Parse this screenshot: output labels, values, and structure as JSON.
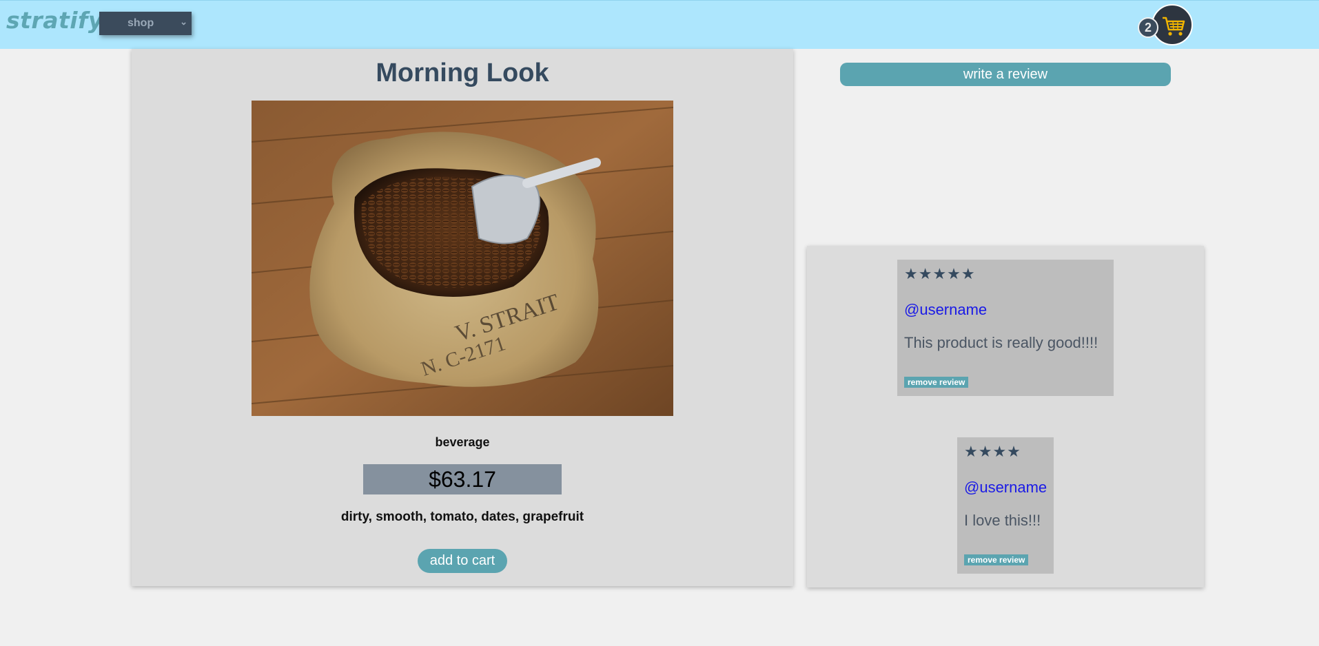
{
  "header": {
    "logo": "stratify",
    "shop_select": {
      "selected": "shop"
    },
    "cart": {
      "count": "2",
      "icon": "cart-icon"
    }
  },
  "product": {
    "title": "Morning Look",
    "category": "beverage",
    "price": "$63.17",
    "tags": "dirty, smooth, tomato, dates, grapefruit",
    "add_to_cart_label": "add to cart"
  },
  "reviews": {
    "write_review_label": "write a review",
    "items": [
      {
        "stars": "★★★★★",
        "user": "@username",
        "text": "This product is really good!!!!",
        "remove_label": "remove review"
      },
      {
        "stars": "★★★★",
        "user": "@username",
        "text": "I love this!!!",
        "remove_label": "remove review"
      }
    ]
  },
  "colors": {
    "header_bg": "#ade6fd",
    "accent": "#5ba4b0",
    "title": "#354a5f",
    "username_link": "#1a1ae6"
  }
}
